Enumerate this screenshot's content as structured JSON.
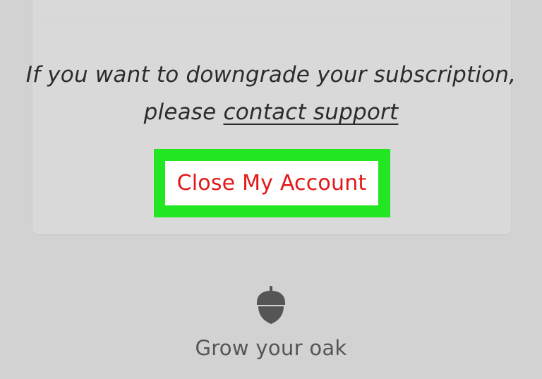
{
  "card": {
    "message_prefix": "If you want to downgrade your subscription, please ",
    "support_link_label": "contact support"
  },
  "close_account_button": {
    "label": "Close My Account",
    "highlight_color": "#22e622",
    "text_color": "#e31818"
  },
  "footer": {
    "icon": "acorn-icon",
    "label": "Grow your oak"
  }
}
